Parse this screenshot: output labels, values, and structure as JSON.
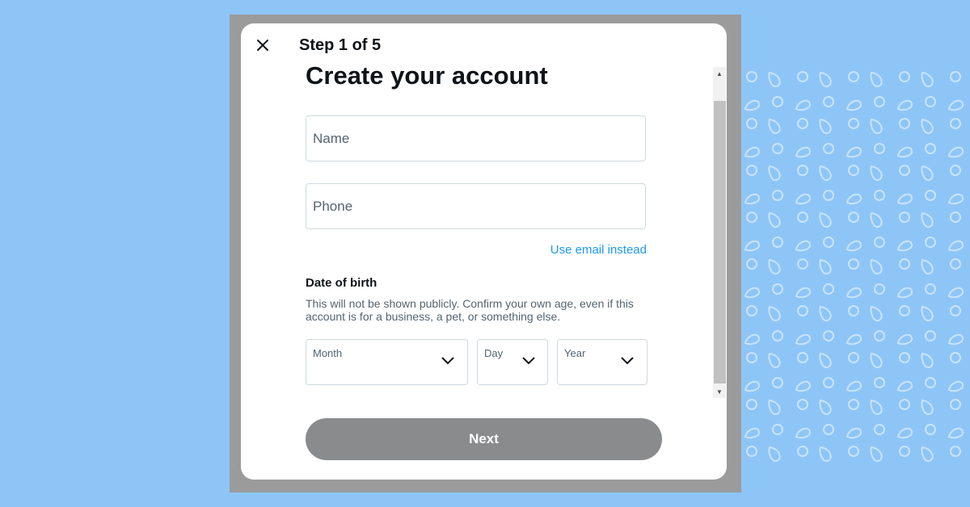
{
  "step": "Step 1 of 5",
  "title": "Create your account",
  "fields": {
    "name": {
      "placeholder": "Name",
      "value": ""
    },
    "phone": {
      "placeholder": "Phone",
      "value": ""
    }
  },
  "use_email_link": "Use email instead",
  "dob": {
    "title": "Date of birth",
    "description": "This will not be shown publicly. Confirm your own age, even if this account is for a business, a pet, or something else.",
    "month_label": "Month",
    "day_label": "Day",
    "year_label": "Year"
  },
  "next_button": "Next",
  "icons": {
    "close": "close-icon",
    "chevron": "chevron-down-icon",
    "scroll_up": "scroll-up-arrow-icon",
    "scroll_down": "scroll-down-arrow-icon"
  },
  "colors": {
    "background": "#8ec5f7",
    "overlay": "#9b9b9b",
    "link": "#1d9bf0",
    "button": "#8a8b8d",
    "text": "#0f1419",
    "muted_text": "#536471"
  }
}
